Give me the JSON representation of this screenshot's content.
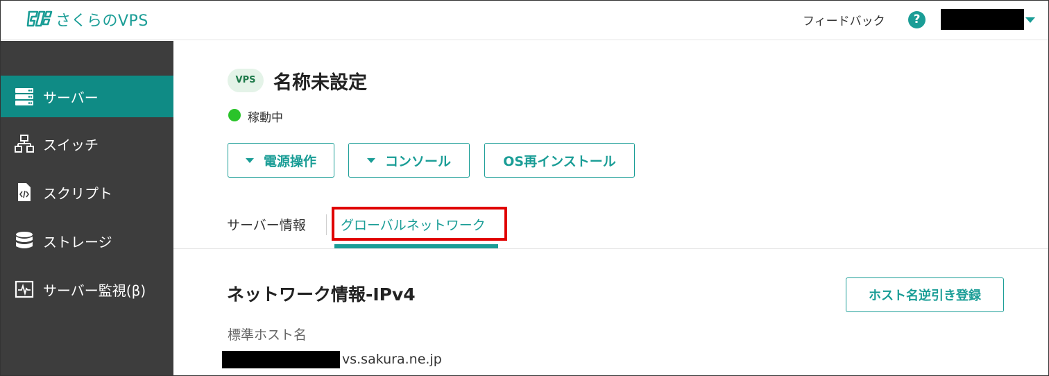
{
  "header": {
    "logo_text": "さくらのVPS",
    "feedback_label": "フィードバック",
    "help_icon": "?",
    "colors": {
      "brand": "#1a9d96"
    }
  },
  "sidebar": {
    "items": [
      {
        "label": "サーバー",
        "icon": "server-icon",
        "active": true
      },
      {
        "label": "スイッチ",
        "icon": "switch-icon",
        "active": false
      },
      {
        "label": "スクリプト",
        "icon": "script-icon",
        "active": false
      },
      {
        "label": "ストレージ",
        "icon": "storage-icon",
        "active": false
      },
      {
        "label": "サーバー監視(β)",
        "icon": "monitor-icon",
        "active": false
      }
    ],
    "colors": {
      "background": "#3d3d3d",
      "active": "#0f8b85"
    }
  },
  "server": {
    "badge": "VPS",
    "name": "名称未設定",
    "status": "稼動中",
    "status_color": "#2ac32a"
  },
  "actions": {
    "power_label": "電源操作",
    "console_label": "コンソール",
    "reinstall_label": "OS再インストール"
  },
  "tabs": [
    {
      "label": "サーバー情報",
      "active": false
    },
    {
      "label": "グローバルネットワーク",
      "active": true
    }
  ],
  "network": {
    "section_title": "ネットワーク情報-IPv4",
    "reverse_dns_button": "ホスト名逆引き登録",
    "hostname_label": "標準ホスト名",
    "hostname_suffix": "vs.sakura.ne.jp"
  }
}
